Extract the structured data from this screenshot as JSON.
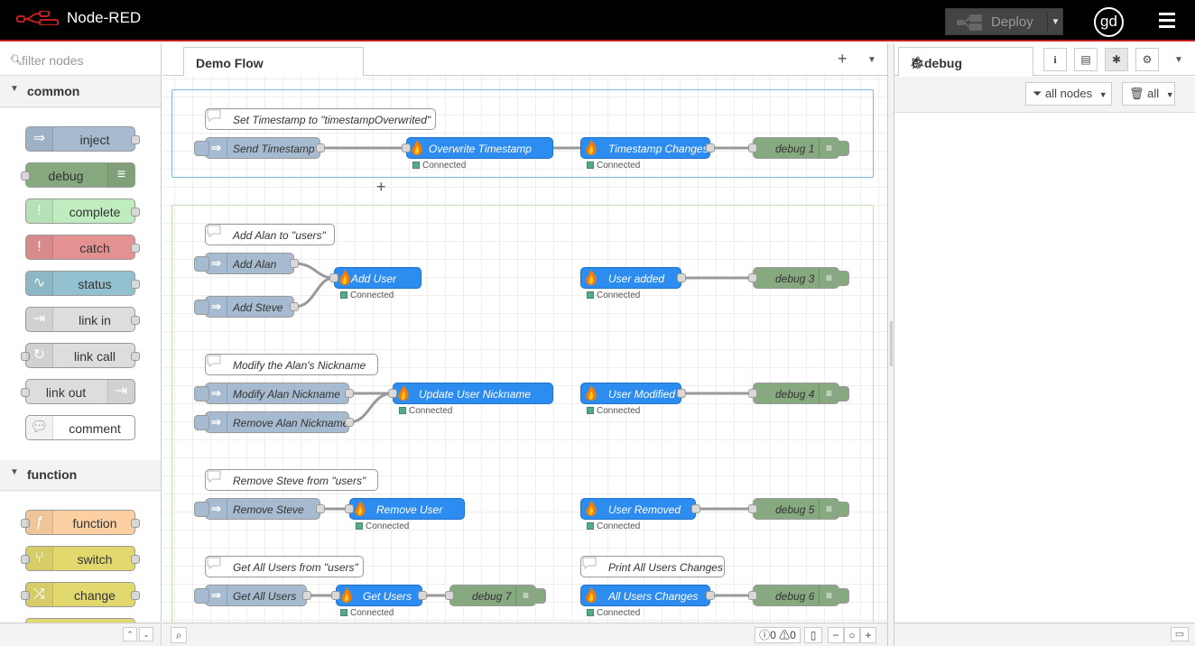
{
  "app": {
    "title": "Node-RED",
    "deploy_label": "Deploy",
    "user_initials": "gd"
  },
  "palette": {
    "filter_placeholder": "filter nodes",
    "categories": [
      {
        "name": "common",
        "nodes": [
          "inject",
          "debug",
          "complete",
          "catch",
          "status",
          "link in",
          "link call",
          "link out",
          "comment"
        ]
      },
      {
        "name": "function",
        "nodes": [
          "function",
          "switch",
          "change"
        ]
      }
    ]
  },
  "workspace": {
    "tab": "Demo Flow",
    "comments": [
      "Set Timestamp to \"timestampOverwrited\"",
      "Add Alan to \"users\"",
      "Modify the Alan's Nickname",
      "Remove Steve from \"users\"",
      "Get All Users from \"users\"",
      "Print All Users Changes"
    ],
    "inject_nodes": [
      "Send Timestamp",
      "Add Alan",
      "Add Steve",
      "Modify Alan Nickname",
      "Remove Alan Nickname",
      "Remove Steve",
      "Get All Users"
    ],
    "firestore_out_nodes": [
      "Overwrite Timestamp",
      "Add User",
      "Update User Nickname",
      "Remove User",
      "Get Users"
    ],
    "firestore_in_nodes": [
      "Timestamp Changes",
      "User added",
      "User Modified",
      "User Removed",
      "All Users Changes"
    ],
    "debug_nodes": [
      "debug 1",
      "debug 3",
      "debug 4",
      "debug 5",
      "debug 7",
      "debug 6"
    ],
    "status_text": "Connected",
    "footer": {
      "errors": "0",
      "warnings": "0"
    }
  },
  "sidebar": {
    "active_tab": "debug",
    "filter_nodes": "all nodes",
    "clear_label": "all"
  },
  "colors": {
    "inject": "#a6bbcf",
    "debug": "#87a980",
    "firestore": "#2d8cf0",
    "group1_border": "#7fb7df",
    "group2_border": "#c0e0b0"
  }
}
